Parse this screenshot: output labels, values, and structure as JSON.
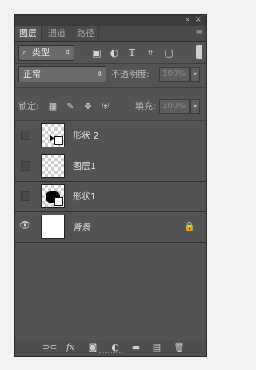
{
  "window": {
    "collapse_glyph": "«",
    "close_glyph": "×",
    "menu_glyph": "≡"
  },
  "tabs": [
    {
      "label": "图层",
      "active": true
    },
    {
      "label": "通道",
      "active": false
    },
    {
      "label": "路径",
      "active": false
    }
  ],
  "filter": {
    "kind_label": "类型",
    "icons": [
      "image-filter-icon",
      "adjustment-filter-icon",
      "type-filter-icon",
      "shape-filter-icon",
      "smart-object-filter-icon"
    ],
    "icon_glyphs": [
      "▣",
      "◐",
      "T",
      "⌗",
      "▢"
    ]
  },
  "blend": {
    "mode": "正常",
    "opacity_label": "不透明度:",
    "opacity_value": "100%"
  },
  "lock": {
    "label": "锁定:",
    "fill_label": "填充:",
    "fill_value": "100%"
  },
  "layers": [
    {
      "name": "形状 2",
      "visible": false,
      "thumb": "transparent-shape",
      "italic": false,
      "locked": false
    },
    {
      "name": "图层1",
      "visible": false,
      "thumb": "transparent",
      "italic": false,
      "locked": false
    },
    {
      "name": "形状1",
      "visible": false,
      "thumb": "black-shape",
      "italic": false,
      "locked": false
    },
    {
      "name": "背景",
      "visible": true,
      "thumb": "white",
      "italic": true,
      "locked": true
    }
  ],
  "bottom_icons": [
    "link-layers-icon",
    "fx-icon",
    "layer-mask-icon",
    "adjustment-layer-icon",
    "new-group-icon",
    "new-layer-icon",
    "delete-layer-icon"
  ],
  "bottom_glyphs": [
    "⊃⊂",
    "fx",
    "◙",
    "◐",
    "▬",
    "▤",
    "🗑"
  ]
}
